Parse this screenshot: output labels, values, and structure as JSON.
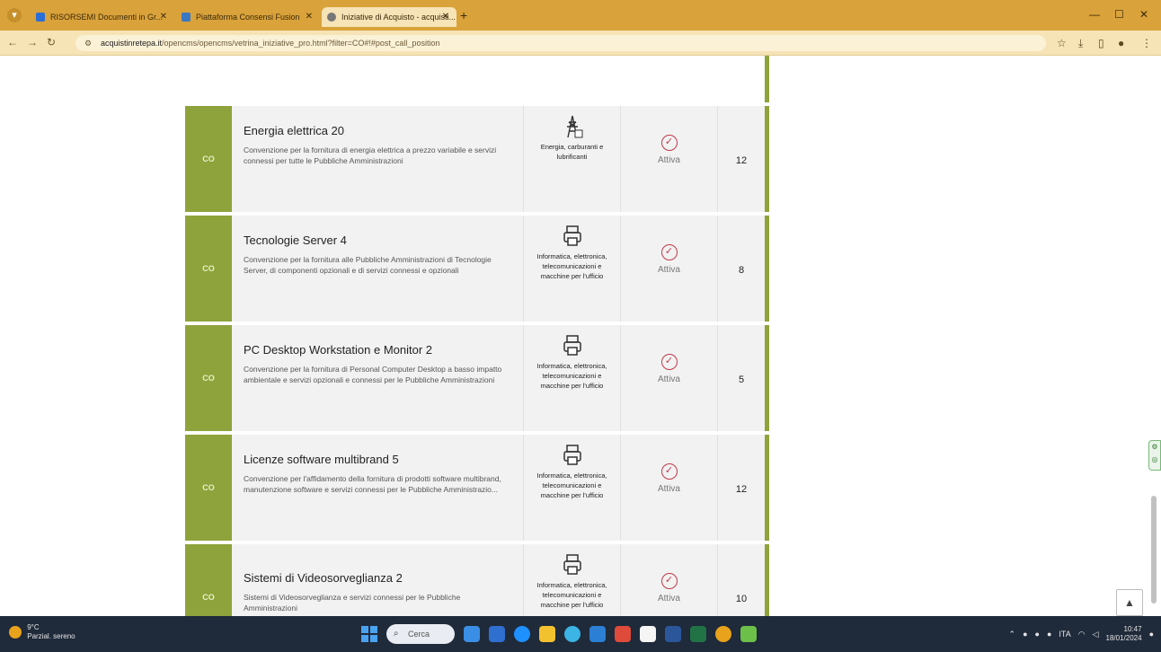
{
  "browser": {
    "tabs": [
      {
        "label": "RISORSEMI Documenti in Gr..."
      },
      {
        "label": "Piattaforma Consensi Fusion"
      },
      {
        "label": "Iniziative di Acquisto - acquisti..."
      }
    ],
    "url": {
      "host": "acquistinretepa.it",
      "path": "/opencms/opencms/vetrina_iniziative_pro.html?filter=CO#!#post_call_position"
    }
  },
  "page": {
    "cards": [
      {
        "tag": "CO",
        "title": "Energia elettrica 20",
        "description": "Convenzione per la fornitura di energia elettrica a prezzo variabile e servizi connessi per tutte le Pubbliche Amministrazioni",
        "category": "Energia, carburanti e lubrificanti",
        "category_icon": "power-pylon-icon",
        "status": "Attiva",
        "count": "12"
      },
      {
        "tag": "CO",
        "title": "Tecnologie Server 4",
        "description": "Convenzione per la fornitura alle Pubbliche Amministrazioni di Tecnologie Server, di componenti opzionali e di servizi connessi e opzionali",
        "category": "Informatica, elettronica, telecomunicazioni e macchine per l'ufficio",
        "category_icon": "printer-icon",
        "status": "Attiva",
        "count": "8"
      },
      {
        "tag": "CO",
        "title": "PC Desktop Workstation e Monitor 2",
        "description": "Convenzione per la fornitura di Personal Computer Desktop a basso impatto ambientale e servizi opzionali e connessi per le Pubbliche Amministrazioni",
        "category": "Informatica, elettronica, telecomunicazioni e macchine per l'ufficio",
        "category_icon": "printer-icon",
        "status": "Attiva",
        "count": "5"
      },
      {
        "tag": "CO",
        "title": "Licenze software multibrand 5",
        "description": "Convenzione per l'affidamento della fornitura di prodotti software multibrand, manutenzione software e servizi connessi per le Pubbliche Amministrazio...",
        "category": "Informatica, elettronica, telecomunicazioni e macchine per l'ufficio",
        "category_icon": "printer-icon",
        "status": "Attiva",
        "count": "12"
      },
      {
        "tag": "CO",
        "title": "Sistemi di Videosorveglianza 2",
        "description": "Sistemi di Videosorveglianza e servizi connessi per le Pubbliche Amministrazioni",
        "category": "Informatica, elettronica, telecomunicazioni e macchine per l'ufficio",
        "category_icon": "printer-icon",
        "status": "Attiva",
        "count": "10"
      }
    ],
    "back_to_top": "▲"
  },
  "taskbar": {
    "weather_temp": "9°C",
    "weather_text": "Parzial. sereno",
    "search_placeholder": "Cerca",
    "time": "10:47",
    "date": "18/01/2024",
    "lang": "ITA"
  }
}
